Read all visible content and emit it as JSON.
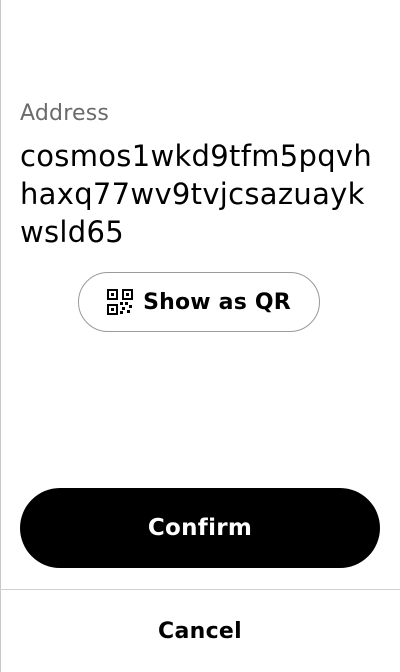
{
  "address": {
    "label": "Address",
    "value": "cosmos1wkd9tfm5pqvhhaxq77wv9tvjcsazuaykwsld65"
  },
  "qr_button": {
    "icon": "qr-code-icon",
    "label": "Show as QR"
  },
  "actions": {
    "confirm_label": "Confirm",
    "cancel_label": "Cancel"
  },
  "colors": {
    "primary_button_bg": "#000000",
    "primary_button_text": "#ffffff",
    "label_gray": "#6b6b6b",
    "outline_gray": "#9a9a9a"
  }
}
